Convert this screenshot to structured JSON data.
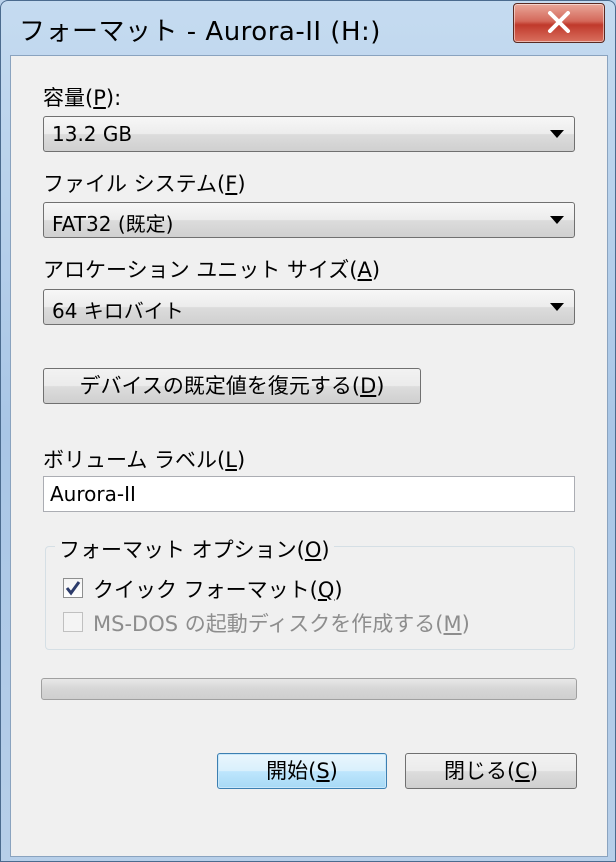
{
  "window": {
    "title": "フォーマット - Aurora-II (H:)"
  },
  "capacity": {
    "label_pre": "容量(",
    "label_key": "P",
    "label_post": "):",
    "selected": "13.2 GB"
  },
  "filesystem": {
    "label_pre": "ファイル システム(",
    "label_key": "F",
    "label_post": ")",
    "selected": "FAT32 (既定)"
  },
  "allocation": {
    "label_pre": "アロケーション ユニット サイズ(",
    "label_key": "A",
    "label_post": ")",
    "selected": "64 キロバイト"
  },
  "restore_defaults": {
    "label_pre": "デバイスの既定値を復元する(",
    "label_key": "D",
    "label_post": ")"
  },
  "volume_label": {
    "label_pre": "ボリューム ラベル(",
    "label_key": "L",
    "label_post": ")",
    "value": "Aurora-II"
  },
  "format_options": {
    "group_pre": "フォーマット オプション(",
    "group_key": "O",
    "group_post": ")",
    "quick_format": {
      "label_pre": "クイック フォーマット(",
      "label_key": "Q",
      "label_post": ")",
      "checked": true
    },
    "msdos_startup": {
      "label_pre": "MS-DOS の起動ディスクを作成する(",
      "label_key": "M",
      "label_post": ")",
      "checked": false,
      "enabled": false
    }
  },
  "progress": {
    "fraction": 0
  },
  "buttons": {
    "start_pre": "開始(",
    "start_key": "S",
    "start_post": ")",
    "close_pre": "閉じる(",
    "close_key": "C",
    "close_post": ")"
  },
  "icons": {
    "close": "close-icon",
    "dropdown": "chevron-down-icon",
    "check": "checkmark-icon"
  }
}
